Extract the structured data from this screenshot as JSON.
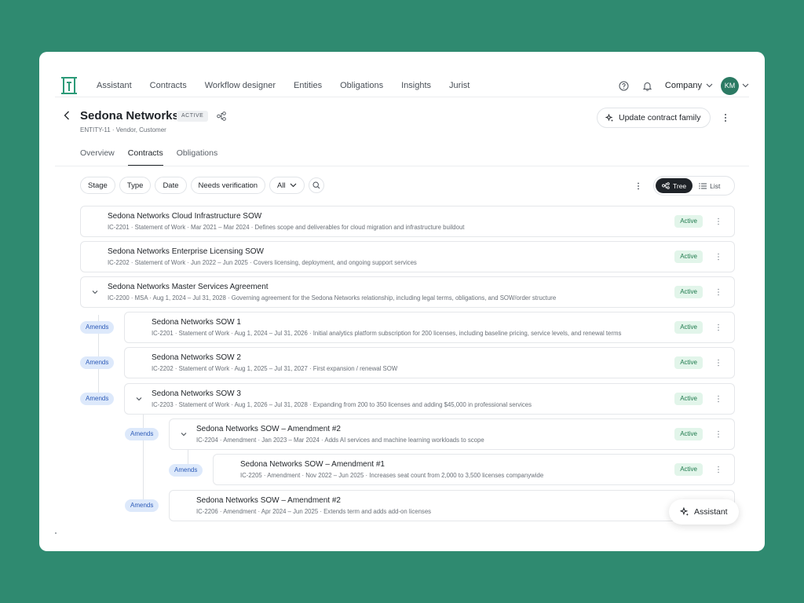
{
  "nav": {
    "items": [
      "Assistant",
      "Contracts",
      "Workflow designer",
      "Entities",
      "Obligations",
      "Insights",
      "Jurist"
    ],
    "company_label": "Company",
    "avatar_initials": "KM",
    "brand_color": "#2b9a78"
  },
  "header": {
    "title": "Sedona Networks",
    "badge": "ACTIVE",
    "subtitle": "ENTITY-11 · Vendor, Customer",
    "update_button": "Update contract family"
  },
  "tabs": [
    {
      "label": "Overview",
      "active": false
    },
    {
      "label": "Contracts",
      "active": true
    },
    {
      "label": "Obligations",
      "active": false
    }
  ],
  "filters": {
    "chips": [
      "Stage",
      "Type",
      "Date",
      "Needs verification"
    ],
    "all_select": "All"
  },
  "view_toggle": {
    "tree_label": "Tree",
    "list_label": "List",
    "selected": "Tree"
  },
  "contracts": [
    {
      "name": "Sedona Networks Cloud Infrastructure SOW",
      "meta": "IC-2201 · Statement of Work · Mar 2021 – Mar 2024  ·  Defines scope and deliverables for cloud migration and infrastructure buildout",
      "status": "Active"
    },
    {
      "name": "Sedona Networks Enterprise Licensing SOW",
      "meta": "IC-2202 · Statement of Work · Jun 2022 – Jun 2025  ·  Covers licensing, deployment, and ongoing support services",
      "status": "Active"
    },
    {
      "name": "Sedona Networks Master Services Agreement",
      "meta": "IC-2200 · MSA · Aug 1, 2024 – Jul 31, 2028  ·  Governing agreement for the Sedona Networks relationship, including legal terms, obligations, and SOW/order structure",
      "status": "Active"
    },
    {
      "name": "Sedona Networks SOW 1",
      "meta": "IC-2201 · Statement of Work · Aug 1, 2024 – Jul 31, 2026  ·  Initial analytics platform subscription for 200 licenses, including baseline pricing, service levels, and renewal terms",
      "status": "Active",
      "relation": "Amends"
    },
    {
      "name": "Sedona Networks SOW 2",
      "meta": "IC-2202 · Statement of Work · Aug 1, 2025 – Jul 31, 2027  ·  First expansion / renewal SOW",
      "status": "Active",
      "relation": "Amends"
    },
    {
      "name": "Sedona Networks SOW 3",
      "meta": "IC-2203 · Statement of Work · Aug 1, 2026 – Jul 31, 2028  ·  Expanding from 200 to 350 licenses and adding $45,000 in professional services",
      "status": "Active",
      "relation": "Amends"
    },
    {
      "name": "Sedona Networks SOW – Amendment #2",
      "meta": "IC-2204 · Amendment · Jan 2023 – Mar 2024  ·  Adds AI services and machine learning workloads to scope",
      "status": "Active",
      "relation": "Amends"
    },
    {
      "name": "Sedona Networks SOW – Amendment #1",
      "meta": "IC-2205 · Amendment · Nov 2022 – Jun 2025  ·  Increases seat count from 2,000 to 3,500 licenses companywide",
      "status": "Active",
      "relation": "Amends"
    },
    {
      "name": "Sedona Networks SOW – Amendment #2",
      "meta": "IC-2206 · Amendment · Apr 2024 – Jun 2025  ·  Extends term and adds add-on licenses",
      "status": "",
      "relation": "Amends"
    }
  ],
  "assistant_button": "Assistant"
}
